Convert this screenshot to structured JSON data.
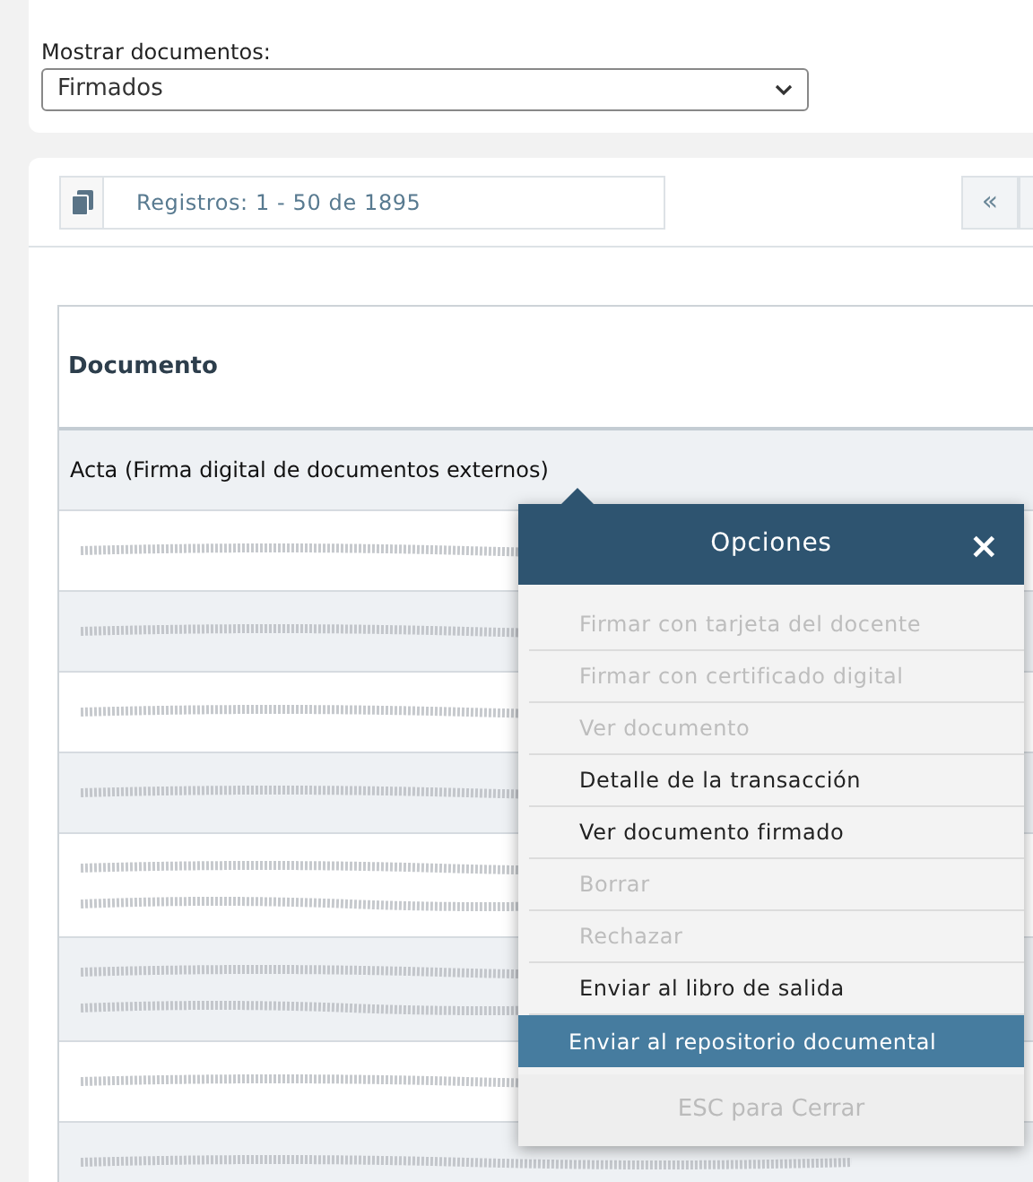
{
  "filter": {
    "label": "Mostrar documentos:",
    "value": "Firmados"
  },
  "toolbar": {
    "records": "Registros: 1 - 50 de 1895",
    "first_page": "«"
  },
  "table": {
    "columns": [
      "Documento"
    ],
    "rows": [
      {
        "kind": "text",
        "label": "Acta (Firma digital de documentos externos)"
      },
      {
        "kind": "redacted"
      },
      {
        "kind": "redacted"
      },
      {
        "kind": "redacted"
      },
      {
        "kind": "redacted"
      },
      {
        "kind": "redacted_double"
      },
      {
        "kind": "redacted_double"
      },
      {
        "kind": "redacted"
      },
      {
        "kind": "redacted"
      }
    ]
  },
  "menu": {
    "title": "Opciones",
    "close": "×",
    "items": [
      {
        "label": "Firmar con tarjeta del docente",
        "disabled": true,
        "selected": false
      },
      {
        "label": "Firmar con certificado digital",
        "disabled": true,
        "selected": false
      },
      {
        "label": "Ver documento",
        "disabled": true,
        "selected": false
      },
      {
        "label": "Detalle de la transacción",
        "disabled": false,
        "selected": false
      },
      {
        "label": "Ver documento firmado",
        "disabled": false,
        "selected": false
      },
      {
        "label": "Borrar",
        "disabled": true,
        "selected": false
      },
      {
        "label": "Rechazar",
        "disabled": true,
        "selected": false
      },
      {
        "label": "Enviar al libro de salida",
        "disabled": false,
        "selected": false
      },
      {
        "label": "Enviar al repositorio documental",
        "disabled": false,
        "selected": true
      }
    ],
    "footer": "ESC para Cerrar"
  }
}
